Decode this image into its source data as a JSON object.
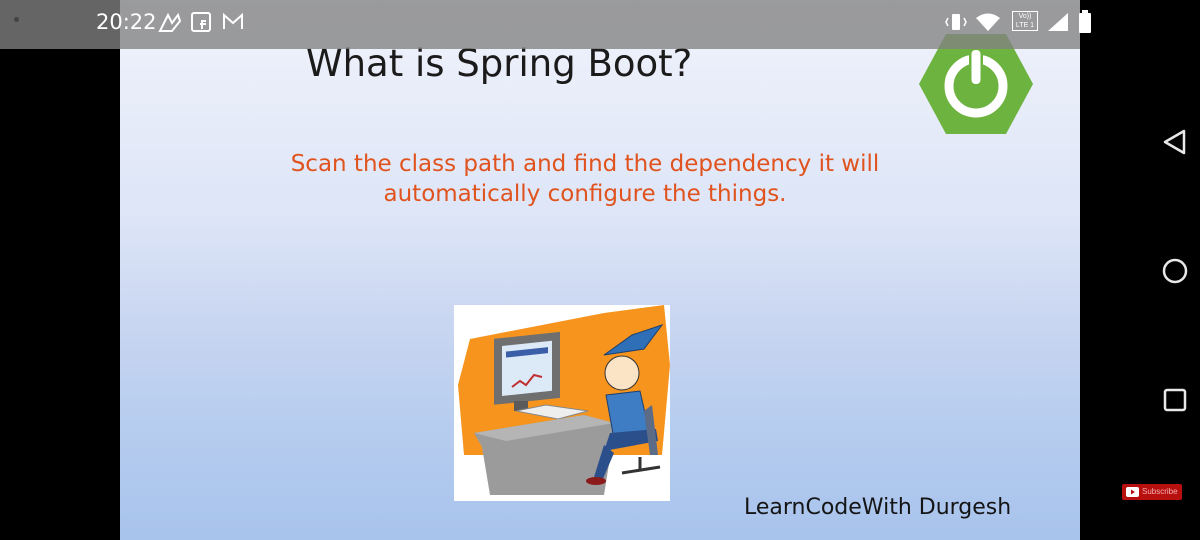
{
  "status_bar": {
    "time": "20:22",
    "icons": [
      "notification-dot",
      "app-notification-icon",
      "facebook-messenger-icon",
      "gmail-icon",
      "vibrate-icon",
      "wifi-icon",
      "volte-icon",
      "signal-icon",
      "battery-icon"
    ],
    "volte_text": "Vo)) LTE 1"
  },
  "slide": {
    "title": "What is Spring Boot?",
    "subtitle_line1": "Scan the class path and find the dependency it will",
    "subtitle_line2": "automatically configure the things.",
    "watermark": "LearnCodeWith Durgesh",
    "logo": "spring-power-logo",
    "illustration": "developer-at-computer-cartoon"
  },
  "subscribe_button": {
    "label": "Subscribe"
  },
  "nav_bar": {
    "buttons": [
      "back",
      "home",
      "recents"
    ]
  },
  "colors": {
    "title": "#1b1b1b",
    "subtitle": "#e0531e",
    "logo": "#6db33f",
    "illustration_bg": "#f7941d"
  }
}
